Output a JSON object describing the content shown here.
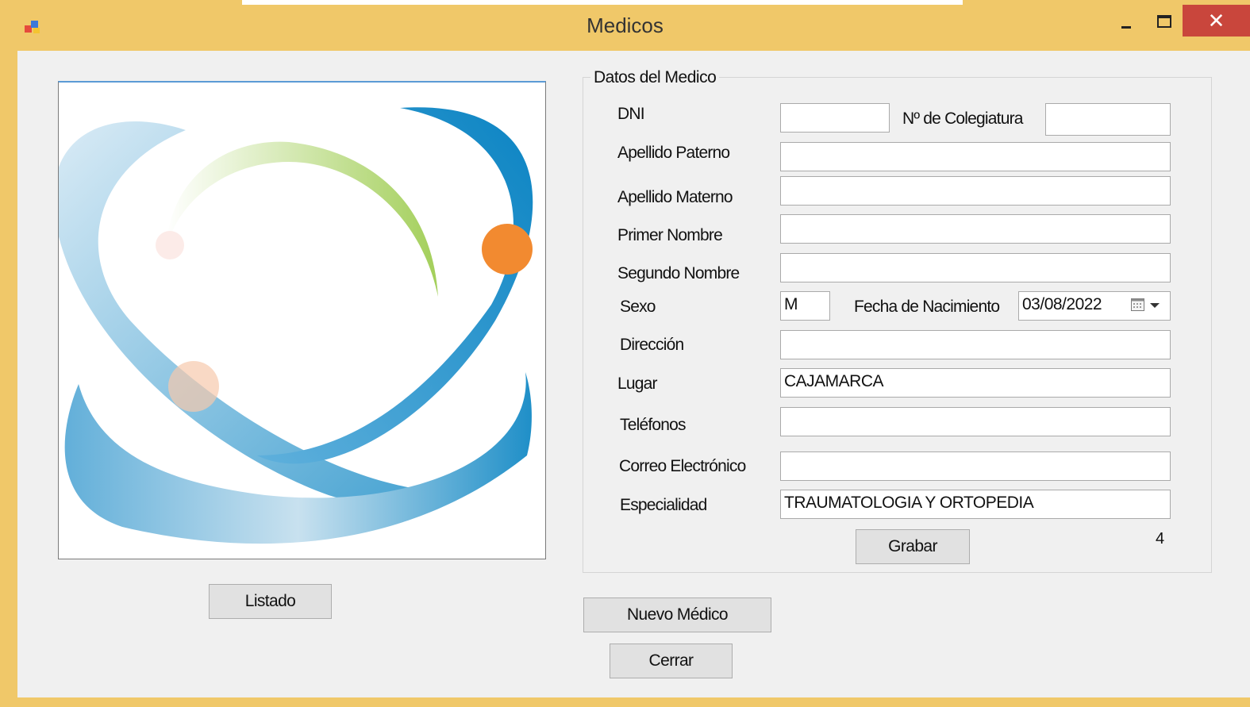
{
  "window": {
    "title": "Medicos",
    "close_glyph": "✕"
  },
  "group": {
    "title": "Datos del Medico"
  },
  "labels": {
    "dni": "DNI",
    "colegiatura": "Nº de Colegiatura",
    "apellido_paterno": "Apellido Paterno",
    "apellido_materno": "Apellido Materno",
    "primer_nombre": "Primer Nombre",
    "segundo_nombre": "Segundo Nombre",
    "sexo": "Sexo",
    "fecha_nacimiento": "Fecha de Nacimiento",
    "direccion": "Dirección",
    "lugar": "Lugar",
    "telefonos": "Teléfonos",
    "correo": "Correo Electrónico",
    "especialidad": "Especialidad"
  },
  "fields": {
    "dni": "",
    "colegiatura": "",
    "apellido_paterno": "",
    "apellido_materno": "",
    "primer_nombre": "",
    "segundo_nombre": "",
    "sexo": "M",
    "fecha_nacimiento": "03/08/2022",
    "direccion": "",
    "lugar": "CAJAMARCA",
    "telefonos": "",
    "correo": "",
    "especialidad": "TRAUMATOLOGIA Y ORTOPEDIA"
  },
  "counter": "4",
  "buttons": {
    "grabar": "Grabar",
    "listado": "Listado",
    "nuevo_medico": "Nuevo Médico",
    "cerrar": "Cerrar"
  },
  "icons": {
    "app": "app-icon",
    "calendar": "calendar-icon",
    "dropdown": "chevron-down-icon"
  },
  "colors": {
    "title_bar": "#f0c869",
    "close_button": "#c9463c",
    "logo_blue": "#1f8fc8",
    "logo_green": "#a3cf5a",
    "logo_orange": "#f28a30"
  }
}
